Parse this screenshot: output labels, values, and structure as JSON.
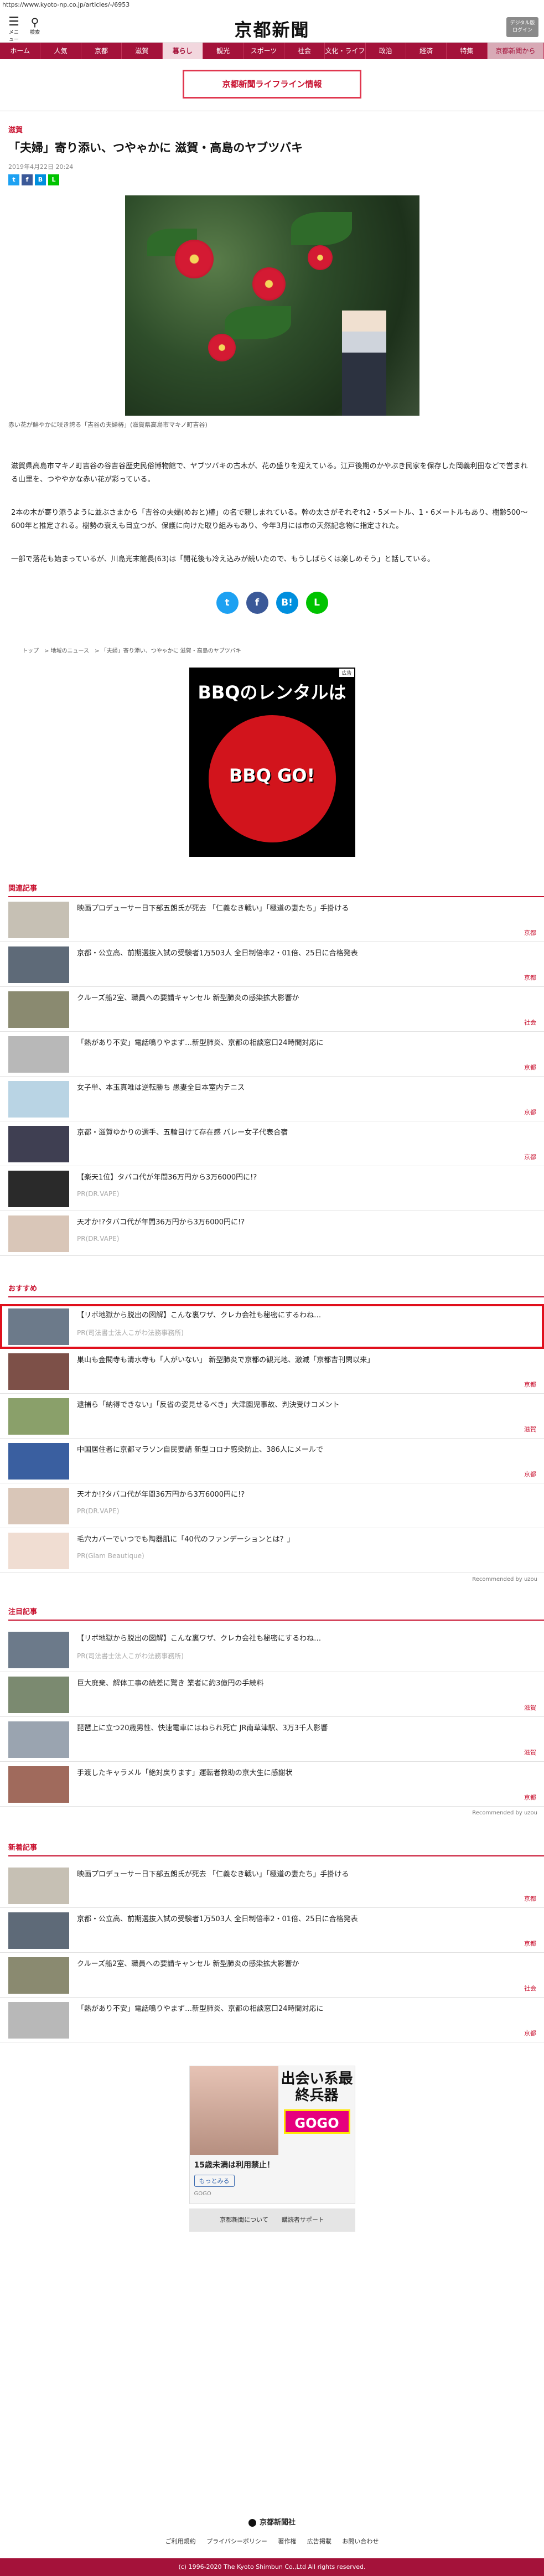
{
  "url": "https://www.kyoto-np.co.jp/articles/-/6953",
  "header": {
    "menu_label": "メニュー",
    "search_label": "検索",
    "logo": "京都新聞",
    "digital": "デジタル版\nログイン"
  },
  "nav": [
    "ホーム",
    "人気",
    "京都",
    "滋賀",
    "暮らし",
    "観光",
    "スポーツ",
    "社会",
    "文化・ライフ",
    "政治",
    "経済",
    "特集",
    "京都新聞から"
  ],
  "banner": "京都新聞ライフライン情報",
  "article": {
    "category": "滋賀",
    "title": "「夫婦」寄り添い、つやゃかに 滋賀・高島のヤブツバキ",
    "date": "2019年4月22日 20:24",
    "caption": "赤い花が鮮やかに咲き誇る「吉谷の夫婦椿」(滋賀県高島市マキノ町吉谷)",
    "paragraphs": [
      "滋賀県高島市マキノ町吉谷の谷吉谷歴史民俗博物館で、ヤブツバキの古木が、花の盛りを迎えている。江戸後期のかやぶき民家を保存した岡義利田などで営まれる山里を、つややかな赤い花が彩っている。",
      "2本の木が寄り添うように並ぶさまから「吉谷の夫婦(めおと)椿」の名で親しまれている。幹の太さがそれぞれ2・5メートル、1・6メートルもあり、樹齢500～600年と推定される。樹勢の衰えも目立つが、保護に向けた取り組みもあり、今年3月には市の天然記念物に指定された。",
      "一部で落花も始まっているが、川島光末館長(63)は「開花後も冷え込みが続いたので、もうしばらくは楽しめそう」と話している。"
    ]
  },
  "breadcrumb": [
    "トップ",
    "地域のニュース",
    "「夫婦」寄り添い、つやゃかに 滋賀・高島のヤブツバキ"
  ],
  "ad_bbq": {
    "title": "BBQのレンタルは",
    "brand": "BBQ GO!",
    "label": "広告"
  },
  "related": {
    "heading": "関連記事",
    "items": [
      {
        "title": "映画プロデューサー日下部五朗氏が死去 「仁義なき戦い」「極道の妻たち」手掛ける",
        "tag": "京都"
      },
      {
        "title": "京都・公立高、前期選抜入試の受験者1万503人 全日制倍率2・01倍、25日に合格発表",
        "tag": "京都"
      },
      {
        "title": "クルーズ船2室、職員への要請キャンセル 新型肺炎の感染拡大影響か",
        "tag": "社会"
      },
      {
        "title": "「熱があり不安」電話鳴りやまず…新型肺炎、京都の相談窓口24時間対応に",
        "tag": "京都"
      },
      {
        "title": "女子単、本玉真唯は逆転勝ち 愚妻全日本室内テニス",
        "tag": "京都"
      },
      {
        "title": "京都・滋賀ゆかりの選手、五輪目けて存在感 バレー女子代表合宿",
        "tag": "京都"
      },
      {
        "title": "【楽天1位】タバコ代が年間36万円から3万6000円に!?",
        "sponsor": "PR(DR.VAPE)"
      },
      {
        "title": "天才か!?タバコ代が年間36万円から3万6000円に!?",
        "sponsor": "PR(DR.VAPE)"
      }
    ]
  },
  "recommend": {
    "heading": "おすすめ",
    "items": [
      {
        "title": "【リボ地獄から脱出の図解】こんな裏ワザ、クレカ会社も秘密にするわね…",
        "sponsor": "PR(司法書士法人こがわ法務事務所)"
      },
      {
        "title": "巣山も金閣寺も清水寺も「人がいない」 新型肺炎で京都の観光地、激減「京都吉刊閑以来」",
        "tag": "京都"
      },
      {
        "title": "逮捕ら「納得できない」「反省の姿見せるべき」大津園児事故、判決受けコメント",
        "tag": "滋賀"
      },
      {
        "title": "中国居住者に京都マラソン自民要請 新型コロナ感染防止、386人にメールで",
        "tag": "京都"
      },
      {
        "title": "天才か!?タバコ代が年間36万円から3万6000円に!?",
        "sponsor": "PR(DR.VAPE)"
      },
      {
        "title": "毛穴カバーでいつでも陶器肌に「40代のファンデーションとは？」",
        "sponsor": "PR(Glam Beautique)"
      }
    ],
    "powered": "Recommended by uzou"
  },
  "attention": {
    "heading": "注目記事",
    "items": [
      {
        "title": "【リボ地獄から脱出の図解】こんな裏ワザ、クレカ会社も秘密にするわね…",
        "sponsor": "PR(司法書士法人こがわ法務事務所)"
      },
      {
        "title": "巨大廃棄、解体工事の続差に驚き 業者に約3億円の手続料",
        "tag": "滋賀"
      },
      {
        "title": "琵琶上に立つ20歳男性、快速電車にはねられ死亡 JR南草津駅、3万3千人影響",
        "tag": "滋賀"
      },
      {
        "title": "手渡したキャラメル「絶対戻ります」運転者救助の京大生に感謝状",
        "tag": "京都"
      }
    ],
    "powered": "Recommended by uzou"
  },
  "newest": {
    "heading": "新着記事",
    "items": [
      {
        "title": "映画プロデューサー日下部五朗氏が死去 「仁義なき戦い」「極道の妻たち」手掛ける",
        "tag": "京都"
      },
      {
        "title": "京都・公立高、前期選抜入試の受験者1万503人 全日制倍率2・01倍、25日に合格発表",
        "tag": "京都"
      },
      {
        "title": "クルーズ船2室、職員への要請キャンセル 新型肺炎の感染拡大影響か",
        "tag": "社会"
      },
      {
        "title": "「熱があり不安」電話鳴りやまず…新型肺炎、京都の相談窓口24時間対応に",
        "tag": "京都"
      }
    ]
  },
  "ad_go": {
    "title": "出会い系最終兵器",
    "brand": "GOGO",
    "note": "15歳未満は利用禁止！",
    "button": "もっとみる",
    "small": "GOGO"
  },
  "links": [
    "京都新聞について",
    "購読者サポート"
  ],
  "footer": {
    "company": "京都新聞社",
    "links": [
      "ご利用規約",
      "プライバシーポリシー",
      "著作権",
      "広告掲載",
      "お問い合わせ"
    ],
    "copyright": "(c) 1996-2020 The Kyoto Shimbun Co.,Ltd All rights reserved."
  },
  "colors": {
    "brand": "#a4123a",
    "accent": "#c8102e"
  }
}
